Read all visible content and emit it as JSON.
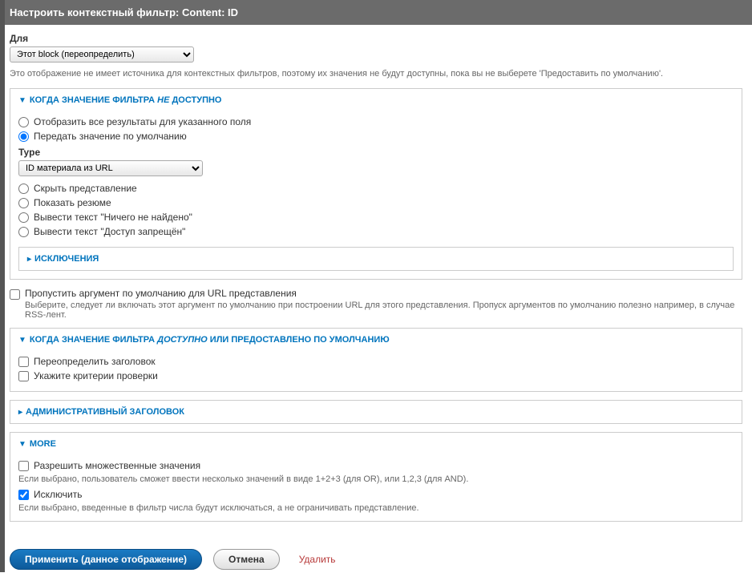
{
  "header": {
    "title": "Настроить контекстный фильтр: Content: ID"
  },
  "for": {
    "label": "Для",
    "value": "Этот block (переопределить)"
  },
  "info": "Это отображение не имеет источника для контекстных фильтров, поэтому их значения не будут доступны, пока вы не выберете 'Предоставить по умолчанию'.",
  "section_not_available": {
    "title_prefix": "КОГДА ЗНАЧЕНИЕ ФИЛЬТРА ",
    "title_italic": "НЕ",
    "title_suffix": " ДОСТУПНО",
    "options": {
      "show_all": "Отобразить все результаты для указанного поля",
      "default": "Передать значение по умолчанию",
      "type_label": "Type",
      "type_value": "ID материала из URL",
      "hide": "Скрыть представление",
      "summary": "Показать резюме",
      "not_found": "Вывести текст \"Ничего не найдено\"",
      "forbidden": "Вывести текст \"Доступ запрещён\""
    },
    "exceptions": "ИСКЛЮЧЕНИЯ"
  },
  "skip": {
    "label": "Пропустить аргумент по умолчанию для URL представления",
    "help": "Выберите, следует ли включать этот аргумент по умолчанию при построении URL для этого представления. Пропуск аргументов по умолчанию полезно например, в случае RSS-лент."
  },
  "section_available": {
    "title_prefix": "КОГДА ЗНАЧЕНИЕ ФИЛЬТРА ",
    "title_italic": "ДОСТУПНО",
    "title_suffix": " ИЛИ ПРЕДОСТАВЛЕНО ПО УМОЛЧАНИЮ",
    "override_title": "Переопределить заголовок",
    "specify_validation": "Укажите критерии проверки"
  },
  "section_admin": {
    "title": "АДМИНИСТРАТИВНЫЙ ЗАГОЛОВОК"
  },
  "section_more": {
    "title": "MORE",
    "multiple": "Разрешить множественные значения",
    "multiple_help": "Если выбрано, пользователь сможет ввести несколько значений в виде 1+2+3 (для OR), или 1,2,3 (для AND).",
    "exclude": "Исключить",
    "exclude_help": "Если выбрано, введенные в фильтр числа будут исключаться, а не ограничивать представление."
  },
  "actions": {
    "apply": "Применить (данное отображение)",
    "cancel": "Отмена",
    "delete": "Удалить"
  }
}
